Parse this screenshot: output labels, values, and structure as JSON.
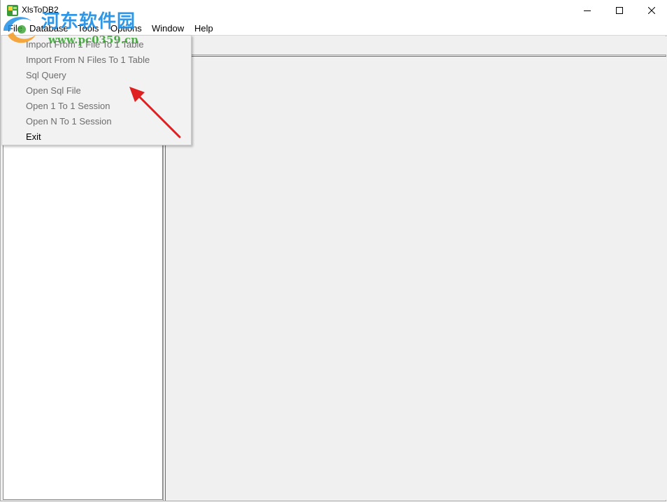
{
  "window": {
    "title": "XlsToDB2",
    "minimize_icon": "minimize-icon",
    "maximize_icon": "maximize-icon",
    "close_icon": "close-icon"
  },
  "menubar": {
    "items": [
      {
        "label": "File"
      },
      {
        "label": "Database"
      },
      {
        "label": "Tools"
      },
      {
        "label": "Options"
      },
      {
        "label": "Window"
      },
      {
        "label": "Help"
      }
    ]
  },
  "file_menu": {
    "items": [
      {
        "label": "Import From 1 File To 1 Table",
        "enabled": false
      },
      {
        "label": "Import From N Files To 1 Table",
        "enabled": false
      },
      {
        "label": "Sql Query",
        "enabled": false
      },
      {
        "label": "Open Sql File",
        "enabled": false
      },
      {
        "label": "Open 1 To 1 Session",
        "enabled": false
      },
      {
        "label": "Open N To 1 Session",
        "enabled": false
      },
      {
        "label": "Exit",
        "enabled": true
      }
    ]
  },
  "watermark": {
    "text": "河东软件园",
    "url": "www.pc0359.cn"
  },
  "colors": {
    "disabled_text": "#6d6d6d",
    "watermark_blue": "#1f8fe6",
    "watermark_green": "#34a02e",
    "annotation_arrow": "#e02020"
  }
}
